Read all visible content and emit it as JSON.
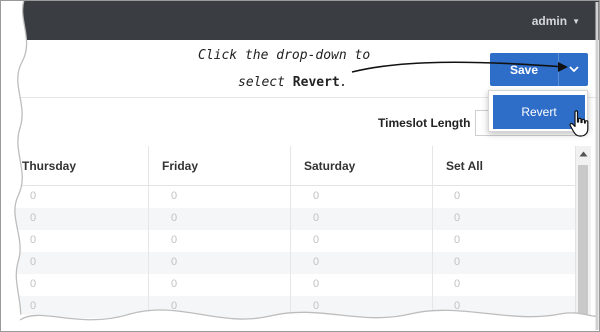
{
  "header": {
    "user_label": "admin"
  },
  "toolbar": {
    "save_label": "Save",
    "toggle_icon": "chevron-down-icon"
  },
  "annotation": {
    "line1": "Click the drop-down to",
    "line2_prefix": "select ",
    "line2_bold": "Revert",
    "line2_suffix": "."
  },
  "dropdown": {
    "items": [
      {
        "label": "Revert"
      }
    ]
  },
  "timeslot": {
    "label": "Timeslot Length",
    "value": ""
  },
  "table": {
    "columns": [
      "Thursday",
      "Friday",
      "Saturday",
      "Set All"
    ],
    "rows": [
      [
        "0",
        "0",
        "0",
        "0"
      ],
      [
        "0",
        "0",
        "0",
        "0"
      ],
      [
        "0",
        "0",
        "0",
        "0"
      ],
      [
        "0",
        "0",
        "0",
        "0"
      ],
      [
        "0",
        "0",
        "0",
        "0"
      ],
      [
        "0",
        "0",
        "0",
        "0"
      ]
    ]
  },
  "colors": {
    "primary": "#2f6ec8",
    "topbar": "#3a3d42"
  }
}
